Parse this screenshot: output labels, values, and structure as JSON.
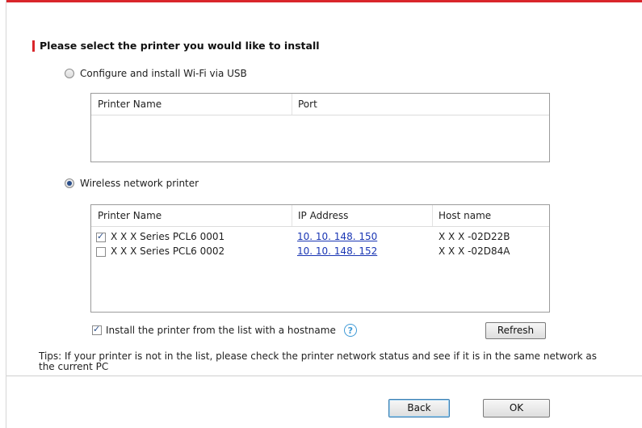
{
  "page": {
    "heading": "Please select the printer you would like to install",
    "accent_color": "#d9262b",
    "link_color": "#1a36b4"
  },
  "usb_option": {
    "label": "Configure and install Wi-Fi via USB",
    "selected": false,
    "table": {
      "columns": [
        "Printer Name",
        "Port"
      ],
      "rows": []
    }
  },
  "wireless_option": {
    "label": "Wireless network printer",
    "selected": true,
    "table": {
      "columns": [
        "Printer Name",
        "IP Address",
        "Host name"
      ],
      "rows": [
        {
          "checked": true,
          "name": "X X X  Series PCL6 0001",
          "ip": "10. 10. 148. 150",
          "host": "X X X -02D22B"
        },
        {
          "checked": false,
          "name": "X X X  Series PCL6 0002",
          "ip": "10. 10. 148. 152",
          "host": "X X X -02D84A"
        }
      ]
    },
    "hostname_checkbox_label": "Install the printer from the list with a hostname",
    "hostname_checked": true,
    "help_icon": "?",
    "refresh_label": "Refresh"
  },
  "tips": "Tips: If your printer is not in the list, please check the printer network status and see if it is in the same network as the current PC",
  "footer": {
    "back_label": "Back",
    "ok_label": "OK"
  }
}
